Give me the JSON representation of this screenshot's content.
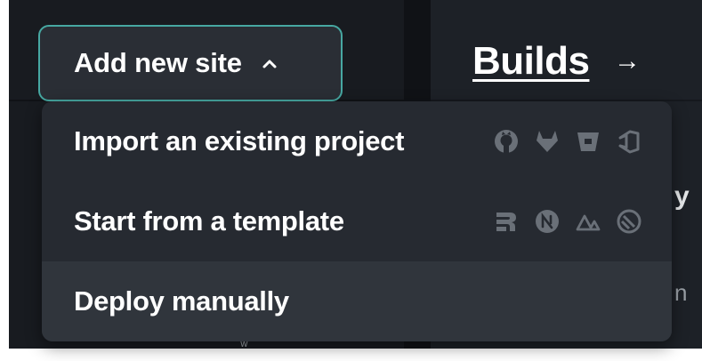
{
  "add_button": {
    "label": "Add new site",
    "chevron_icon": "chevron-up-icon"
  },
  "header": {
    "builds_link": "Builds",
    "arrow": "→"
  },
  "menu": {
    "items": [
      {
        "label": "Import an existing project",
        "icons": [
          "github-icon",
          "gitlab-icon",
          "bitbucket-icon",
          "azure-devops-icon"
        ]
      },
      {
        "label": "Start from a template",
        "icons": [
          "remix-icon",
          "nextjs-icon",
          "nuxt-icon",
          "gatsby-icon"
        ]
      },
      {
        "label": "Deploy manually",
        "icons": []
      }
    ]
  },
  "background": {
    "peek_right_1": "y",
    "peek_right_2": "n",
    "peek_left": "ʬ"
  },
  "colors": {
    "page_bg": "#181b20",
    "menu_bg": "#262a31",
    "menu_hover_bg": "#30353c",
    "button_border": "#47a8a2",
    "text": "#ffffff",
    "icon_muted": "#6a7078"
  }
}
